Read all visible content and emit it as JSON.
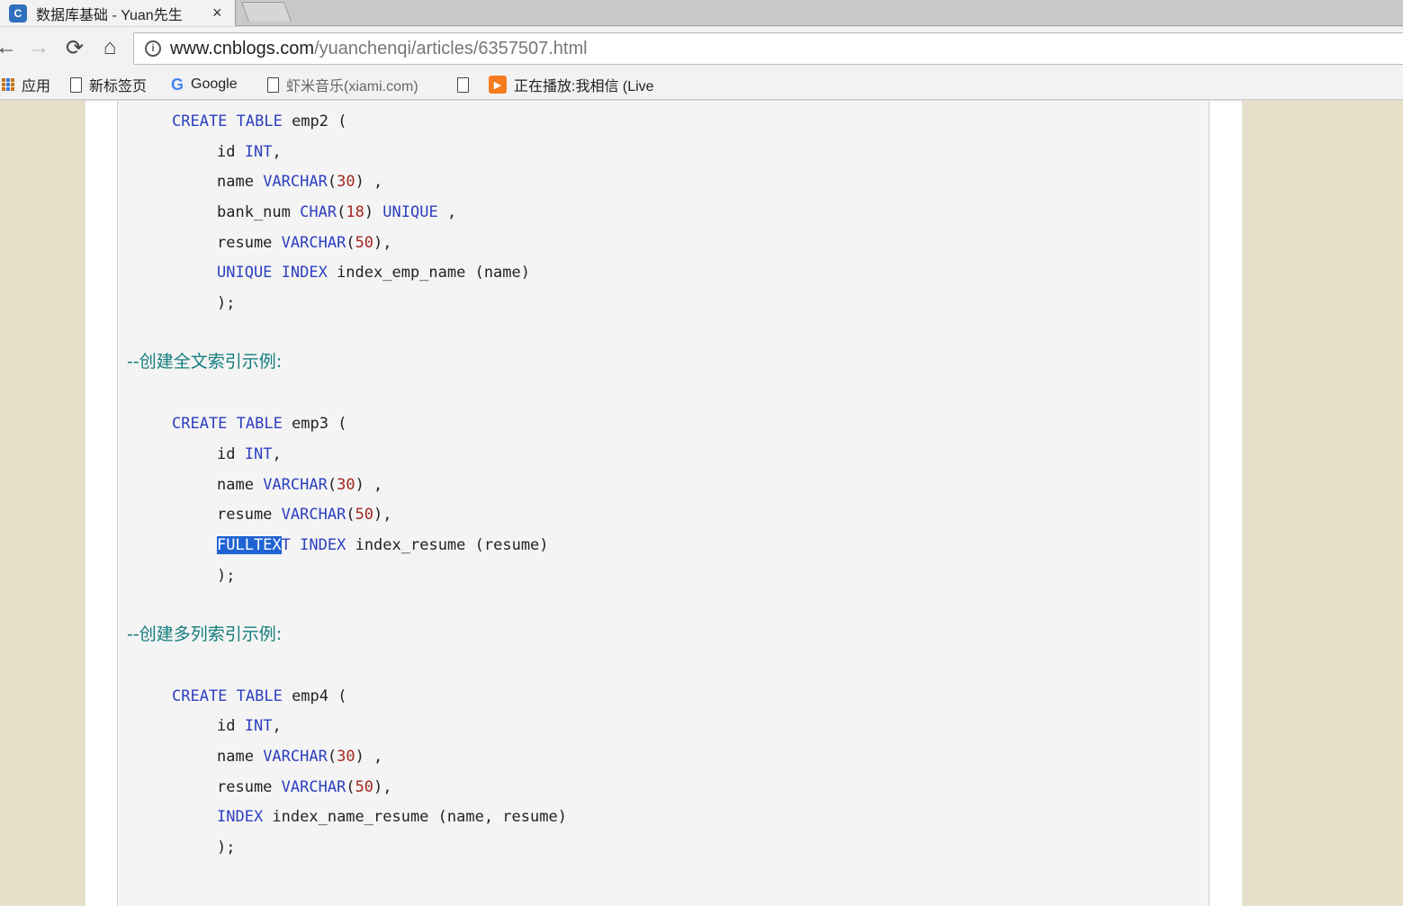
{
  "tab": {
    "title": "数据库基础 - Yuan先生",
    "close": "×"
  },
  "toolbar": {
    "back": "←",
    "forward": "→",
    "reload": "⟳",
    "home": "⌂",
    "url_host": "www.cnblogs.com",
    "url_path": "/yuanchenqi/articles/6357507.html"
  },
  "bookmarks": [
    {
      "icon": "apps-grid-icon",
      "label": "应用"
    },
    {
      "icon": "page-icon",
      "label": "新标签页"
    },
    {
      "icon": "google-icon",
      "label": "Google"
    },
    {
      "icon": "page-icon",
      "label": "虾米音乐(xiami.com)"
    },
    {
      "icon": "page-icon",
      "label": ""
    },
    {
      "icon": "play-icon",
      "label": "正在播放:我相信 (Live"
    }
  ],
  "code": {
    "block1": {
      "create": "CREATE TABLE",
      "table": " emp2 (",
      "l1_a": "id ",
      "l1_kw": "INT",
      "l1_b": ",",
      "l2_a": "name ",
      "l2_kw": "VARCHAR",
      "l2_num_open": "(",
      "l2_num": "30",
      "l2_rest": ") ,",
      "l3_a": "bank_num ",
      "l3_kw": "CHAR",
      "l3_num_open": "(",
      "l3_num": "18",
      "l3_mid": ") ",
      "l3_kw2": "UNIQUE",
      "l3_rest": " ,",
      "l4_a": "resume ",
      "l4_kw": "VARCHAR",
      "l4_num_open": "(",
      "l4_num": "50",
      "l4_rest": "),",
      "l5_kw": "UNIQUE INDEX",
      "l5_rest": " index_emp_name (name)",
      "close": ");"
    },
    "comment2": "--创建全文索引示例:",
    "block2": {
      "create": "CREATE TABLE",
      "table": " emp3 (",
      "l1_a": "id ",
      "l1_kw": "INT",
      "l1_b": ",",
      "l2_a": "name ",
      "l2_kw": "VARCHAR",
      "l2_num_open": "(",
      "l2_num": "30",
      "l2_rest": ") ,",
      "l4_a": "resume ",
      "l4_kw": "VARCHAR",
      "l4_num_open": "(",
      "l4_num": "50",
      "l4_rest": "),",
      "l5_sel": "FULLTEX",
      "l5_kw_rest": "T",
      "l5_kw": "INDEX",
      "l5_rest1": " index_resume (re",
      "l5_rest2": "sume)",
      "close": ");"
    },
    "comment3": "--创建多列索引示例:",
    "block3": {
      "create": "CREATE TABLE",
      "table": " emp4 (",
      "l1_a": "id ",
      "l1_kw": "INT",
      "l1_b": ",",
      "l2_a": "name ",
      "l2_kw": "VARCHAR",
      "l2_num_open": "(",
      "l2_num": "30",
      "l2_rest": ") ,",
      "l4_a": "resume ",
      "l4_kw": "VARCHAR",
      "l4_num_open": "(",
      "l4_num": "50",
      "l4_rest": "),",
      "l5_kw": "INDEX",
      "l5_rest": " index_name_resume (name, resume)",
      "close": ");"
    }
  },
  "colors": {
    "keyword": "#2d3fbf",
    "number": "#a3271f",
    "comment": "#147d7d",
    "selection": "#1f63d4",
    "page_bg": "#e7e1cb"
  }
}
